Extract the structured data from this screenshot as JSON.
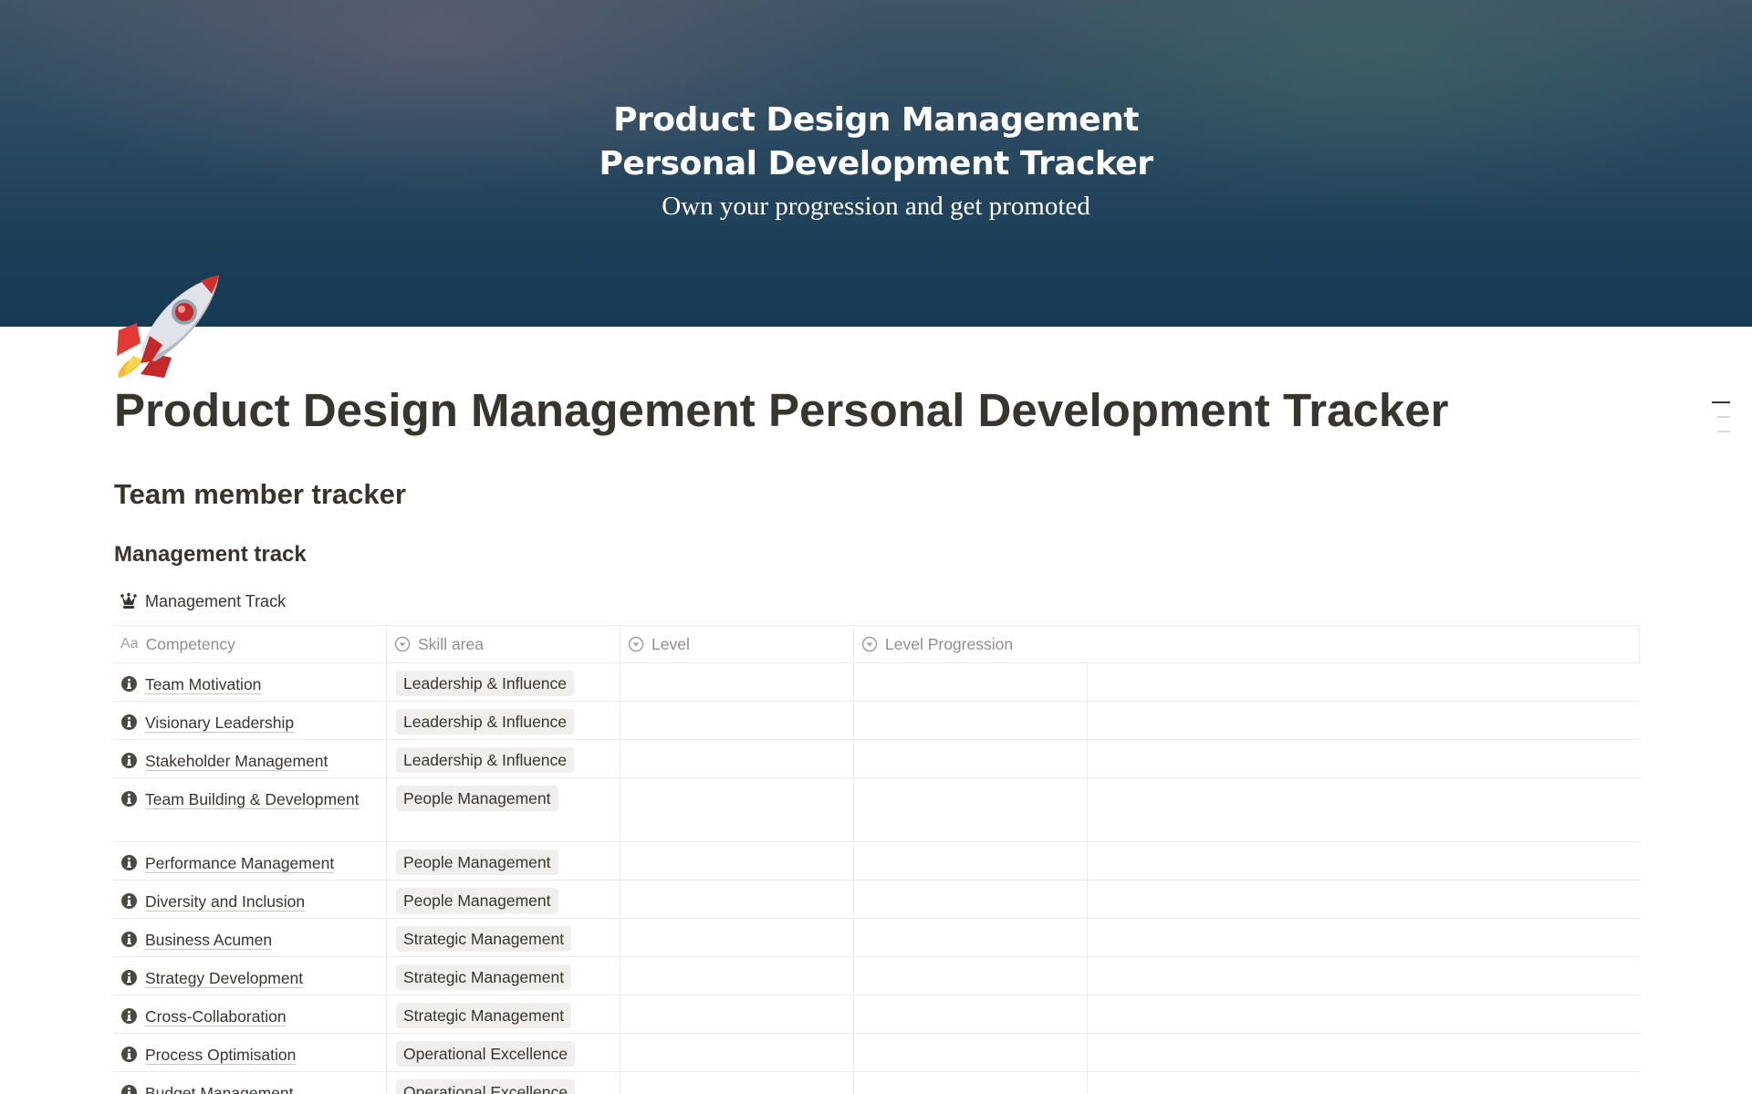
{
  "cover": {
    "title_line1": "Product Design Management",
    "title_line2": "Personal Development Tracker",
    "subtitle": "Own your progression and get promoted"
  },
  "page": {
    "icon": "rocket-icon",
    "title": "Product Design Management Personal Development Tracker",
    "heading": "Team member tracker",
    "subheading": "Management track"
  },
  "database": {
    "icon": "chess-queen-icon",
    "title": "Management Track",
    "columns": [
      {
        "label": "Competency",
        "icon": "text-aa-icon"
      },
      {
        "label": "Skill area",
        "icon": "select-icon"
      },
      {
        "label": "Level",
        "icon": "select-icon"
      },
      {
        "label": "Level Progression",
        "icon": "select-icon"
      }
    ],
    "rows": [
      {
        "competency": "Team Motivation",
        "skill_area": "Leadership & Influence"
      },
      {
        "competency": "Visionary Leadership",
        "skill_area": "Leadership & Influence"
      },
      {
        "competency": "Stakeholder Management",
        "skill_area": "Leadership & Influence"
      },
      {
        "competency": "Team Building & Development",
        "skill_area": "People Management"
      },
      {
        "competency": "Performance Management",
        "skill_area": "People Management"
      },
      {
        "competency": "Diversity and Inclusion",
        "skill_area": "People Management"
      },
      {
        "competency": "Business Acumen",
        "skill_area": "Strategic Management"
      },
      {
        "competency": "Strategy Development",
        "skill_area": "Strategic Management"
      },
      {
        "competency": "Cross-Collaboration",
        "skill_area": "Strategic Management"
      },
      {
        "competency": "Process Optimisation",
        "skill_area": "Operational Excellence"
      },
      {
        "competency": "Budget Management",
        "skill_area": "Operational Excellence"
      }
    ]
  }
}
